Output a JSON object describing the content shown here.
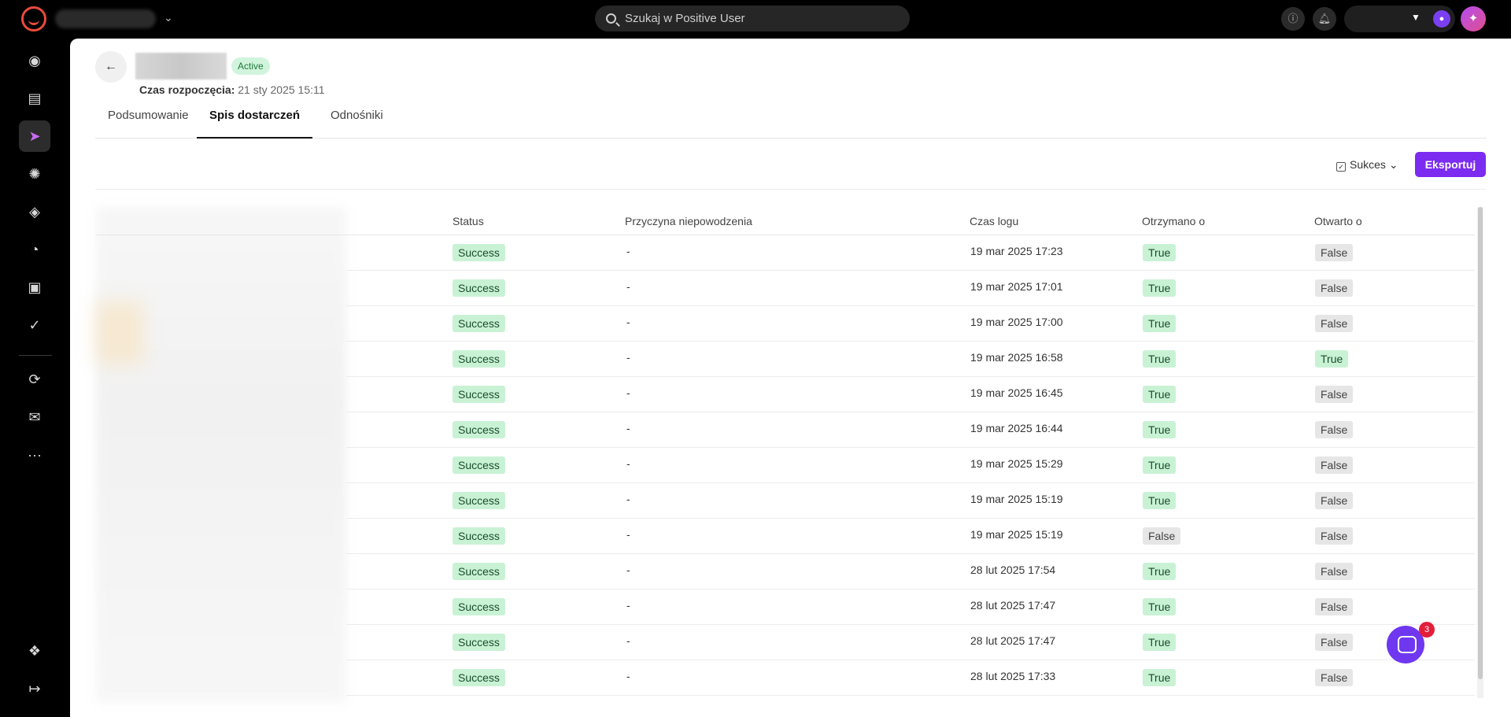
{
  "topbar": {
    "search_placeholder": "Szukaj w Positive User",
    "icons": [
      "logo-icon",
      "chevron-down-icon",
      "search-icon",
      "info-icon",
      "bell-icon",
      "user-icon",
      "sparkle-icon"
    ]
  },
  "sidebar": {
    "items": [
      {
        "icon": "home-icon",
        "glyph": "◉"
      },
      {
        "icon": "folder-icon",
        "glyph": "▤"
      },
      {
        "icon": "send-icon",
        "glyph": "➤"
      },
      {
        "icon": "atom-icon",
        "glyph": "✺"
      },
      {
        "icon": "layers-icon",
        "glyph": "◈"
      },
      {
        "icon": "chart-icon",
        "glyph": "◔"
      },
      {
        "icon": "window-icon",
        "glyph": "▣"
      },
      {
        "icon": "badge-icon",
        "glyph": "✓"
      },
      {
        "icon": "flow-icon",
        "glyph": "⟳"
      },
      {
        "icon": "message-icon",
        "glyph": "✉"
      },
      {
        "icon": "more-icon",
        "glyph": "···"
      },
      {
        "icon": "integrations-icon",
        "glyph": "❖"
      },
      {
        "icon": "logout-icon",
        "glyph": "↦"
      }
    ]
  },
  "header": {
    "status": "Active",
    "start_label": "Czas rozpoczęcia:",
    "start_value": "21 sty 2025 15:11"
  },
  "tabs": [
    "Podsumowanie",
    "Spis dostarczeń",
    "Odnośniki"
  ],
  "toolbar": {
    "filter_label": "Sukces",
    "export_label": "Eksportuj"
  },
  "table": {
    "columns": [
      "Status",
      "Przyczyna niepowodzenia",
      "Czas logu",
      "Otrzymano o",
      "Otwarto o"
    ],
    "rows": [
      {
        "status": "Success",
        "reason": "-",
        "time": "19 mar 2025 17:23",
        "received": "True",
        "opened": "False"
      },
      {
        "status": "Success",
        "reason": "-",
        "time": "19 mar 2025 17:01",
        "received": "True",
        "opened": "False"
      },
      {
        "status": "Success",
        "reason": "-",
        "time": "19 mar 2025 17:00",
        "received": "True",
        "opened": "False"
      },
      {
        "status": "Success",
        "reason": "-",
        "time": "19 mar 2025 16:58",
        "received": "True",
        "opened": "True"
      },
      {
        "status": "Success",
        "reason": "-",
        "time": "19 mar 2025 16:45",
        "received": "True",
        "opened": "False"
      },
      {
        "status": "Success",
        "reason": "-",
        "time": "19 mar 2025 16:44",
        "received": "True",
        "opened": "False"
      },
      {
        "status": "Success",
        "reason": "-",
        "time": "19 mar 2025 15:29",
        "received": "True",
        "opened": "False"
      },
      {
        "status": "Success",
        "reason": "-",
        "time": "19 mar 2025 15:19",
        "received": "True",
        "opened": "False"
      },
      {
        "status": "Success",
        "reason": "-",
        "time": "19 mar 2025 15:19",
        "received": "False",
        "opened": "False"
      },
      {
        "status": "Success",
        "reason": "-",
        "time": "28 lut 2025 17:54",
        "received": "True",
        "opened": "False"
      },
      {
        "status": "Success",
        "reason": "-",
        "time": "28 lut 2025 17:47",
        "received": "True",
        "opened": "False"
      },
      {
        "status": "Success",
        "reason": "-",
        "time": "28 lut 2025 17:47",
        "received": "True",
        "opened": "False"
      },
      {
        "status": "Success",
        "reason": "-",
        "time": "28 lut 2025 17:33",
        "received": "True",
        "opened": "False"
      }
    ]
  },
  "chat": {
    "badge_count": "3"
  }
}
